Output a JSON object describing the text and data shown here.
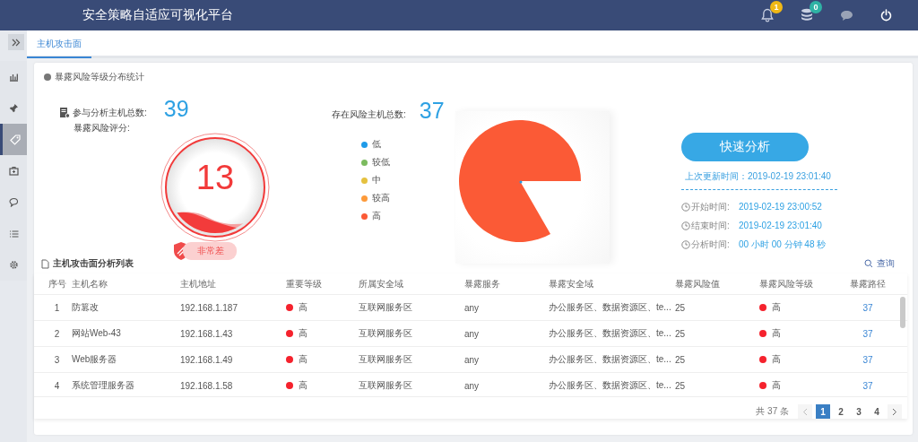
{
  "header": {
    "title": "安全策略自适应可视化平台",
    "icons": [
      {
        "kind": "bell",
        "badge": "1",
        "color": "#f0b816"
      },
      {
        "kind": "database",
        "badge": "0",
        "color": "#2fb3a5"
      },
      {
        "kind": "chat"
      },
      {
        "kind": "power"
      }
    ]
  },
  "sidebar": {
    "items": [
      {
        "kind": "chart",
        "selected": false
      },
      {
        "kind": "pin",
        "selected": false
      },
      {
        "kind": "tag",
        "selected": true
      },
      {
        "kind": "briefcase",
        "selected": false
      },
      {
        "kind": "comment",
        "selected": false
      },
      {
        "kind": "list",
        "selected": false
      },
      {
        "kind": "settings",
        "selected": false
      }
    ]
  },
  "tabs": [
    {
      "label": "主机攻击面",
      "selected": true
    }
  ],
  "stats": {
    "title": "暴露风险等级分布统计",
    "total_label": "参与分析主机总数:",
    "total_value": "39",
    "score_label": "暴露风险评分:",
    "score": "13",
    "score_rating": "非常差",
    "risk_label": "存在风险主机总数:",
    "risk_value": "37",
    "legend": [
      {
        "label": "低",
        "color": "#1e9be9"
      },
      {
        "label": "较低",
        "color": "#7cbb5f"
      },
      {
        "label": "中",
        "color": "#e5c13f"
      },
      {
        "label": "较高",
        "color": "#fd9a3a"
      },
      {
        "label": "高",
        "color": "#fb5a36"
      }
    ]
  },
  "analysis": {
    "button": "快速分析",
    "last_update": "上次更新时间：2019-02-19 23:01:40",
    "times": [
      {
        "label": "开始时间:",
        "value": "2019-02-19 23:00:52"
      },
      {
        "label": "结束时间:",
        "value": "2019-02-19 23:01:40"
      },
      {
        "label": "分析时间:",
        "value": "00 小时 00 分钟 48 秒"
      }
    ]
  },
  "table": {
    "title": "主机攻击面分析列表",
    "search": "查询",
    "columns": [
      "序号",
      "主机名称",
      "主机地址",
      "重要等级",
      "所属安全域",
      "暴露服务",
      "暴露安全域",
      "暴露风险值",
      "暴露风险等级",
      "暴露路径"
    ],
    "rows": [
      {
        "index": "1",
        "name": "防篡改",
        "address": "192.168.1.187",
        "importance": {
          "text": "高",
          "color": "#f5222d"
        },
        "zone": "互联网服务区",
        "service": "any",
        "exposed_zone": "办公服务区、数据资源区、te...",
        "risk_value": "25",
        "risk_level": {
          "text": "高",
          "color": "#f5222d"
        },
        "path": "37"
      },
      {
        "index": "2",
        "name": "网站Web-43",
        "address": "192.168.1.43",
        "importance": {
          "text": "高",
          "color": "#f5222d"
        },
        "zone": "互联网服务区",
        "service": "any",
        "exposed_zone": "办公服务区、数据资源区、te...",
        "risk_value": "25",
        "risk_level": {
          "text": "高",
          "color": "#f5222d"
        },
        "path": "37"
      },
      {
        "index": "3",
        "name": "Web服务器",
        "address": "192.168.1.49",
        "importance": {
          "text": "高",
          "color": "#f5222d"
        },
        "zone": "互联网服务区",
        "service": "any",
        "exposed_zone": "办公服务区、数据资源区、te...",
        "risk_value": "25",
        "risk_level": {
          "text": "高",
          "color": "#f5222d"
        },
        "path": "37"
      },
      {
        "index": "4",
        "name": "系统管理服务器",
        "address": "192.168.1.58",
        "importance": {
          "text": "高",
          "color": "#f5222d"
        },
        "zone": "互联网服务区",
        "service": "any",
        "exposed_zone": "办公服务区、数据资源区、te...",
        "risk_value": "25",
        "risk_level": {
          "text": "高",
          "color": "#f5222d"
        },
        "path": "37"
      }
    ]
  },
  "pagination": {
    "total": "共 37 条",
    "pages": [
      {
        "label": "1",
        "selected": true
      },
      {
        "label": "2",
        "selected": false
      },
      {
        "label": "3",
        "selected": false
      },
      {
        "label": "4",
        "selected": false
      }
    ]
  }
}
